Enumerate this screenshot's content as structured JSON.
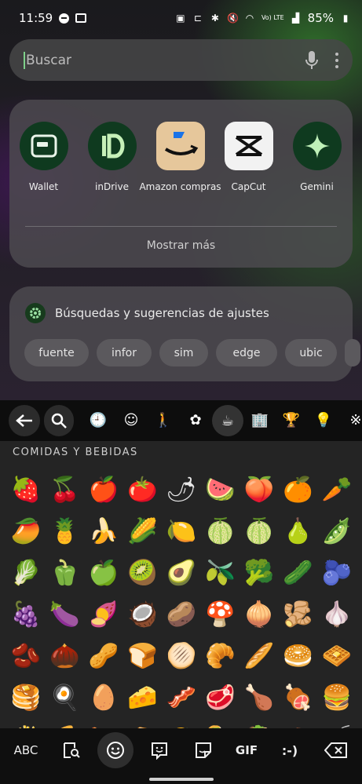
{
  "status_bar": {
    "time": "11:59",
    "battery": "85%",
    "signal_label": "Vo) LTE"
  },
  "search": {
    "placeholder": "Buscar"
  },
  "apps": [
    {
      "label": "Wallet",
      "icon": "wallet-icon",
      "bg": "#0f3a1f"
    },
    {
      "label": "inDrive",
      "icon": "indrive-icon",
      "bg": "#0f3a1f"
    },
    {
      "label": "Amazon compras",
      "icon": "amazon-icon",
      "bg": "#e6c79b"
    },
    {
      "label": "CapCut",
      "icon": "capcut-icon",
      "bg": "#f2f2f2"
    },
    {
      "label": "Gemini",
      "icon": "gemini-icon",
      "bg": "#0f3a1f"
    }
  ],
  "more_label": "Mostrar más",
  "suggestions": {
    "title": "Búsquedas y sugerencias de ajustes",
    "chips": [
      "fuente",
      "infor",
      "sim",
      "edge",
      "ubic"
    ]
  },
  "keyboard": {
    "categories": [
      "recent-clock-icon",
      "smiley-icon",
      "person-icon",
      "nature-icon",
      "food-icon",
      "places-icon",
      "activity-icon",
      "objects-icon",
      "symbols-icon"
    ],
    "section_title": "COMIDAS Y BEBIDAS",
    "emojis": [
      "🍓",
      "🍒",
      "🍎",
      "🍅",
      "🌶",
      "🍉",
      "🍑",
      "🍊",
      "🥕",
      "🥭",
      "🍍",
      "🍌",
      "🌽",
      "🍋",
      "🍈",
      "🍈",
      "🍐",
      "🫛",
      "🥬",
      "🫑",
      "🍏",
      "🥝",
      "🥑",
      "🫒",
      "🥦",
      "🥒",
      "🫐",
      "🍇",
      "🍆",
      "🍠",
      "🥥",
      "🥔",
      "🍄",
      "🧅",
      "🫚",
      "🧄",
      "🫘",
      "🌰",
      "🥜",
      "🍞",
      "🫓",
      "🥐",
      "🥖",
      "🥯",
      "🧇",
      "🥞",
      "🍳",
      "🥚",
      "🧀",
      "🥓",
      "🥩",
      "🍗",
      "🍖",
      "🍔",
      "🍟",
      "🍕",
      "🌭",
      "🥪",
      "🌮",
      "🌯",
      "🥙",
      "🧆",
      "🍝"
    ],
    "bottom": {
      "abc": "ABC",
      "gif": "GIF",
      "emoticon": ":-)"
    }
  }
}
